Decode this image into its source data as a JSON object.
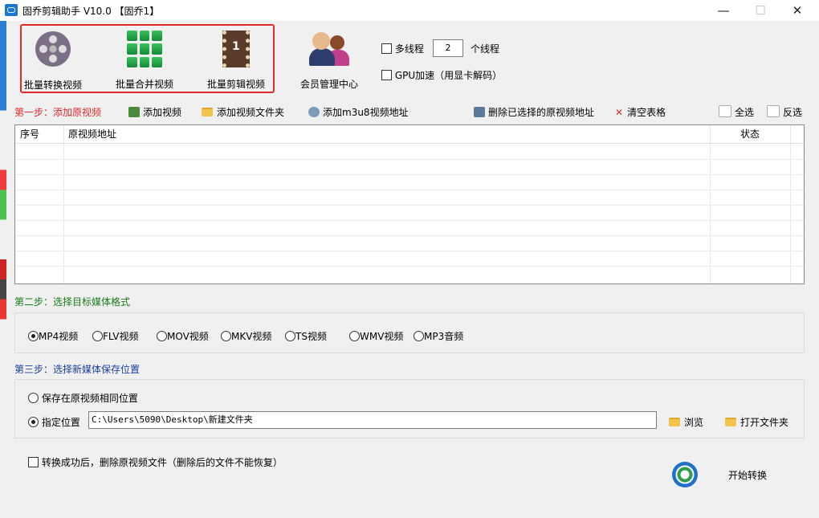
{
  "window": {
    "title": "固乔剪辑助手 V10.0  【固乔1】",
    "minimize": "—",
    "maximize": "☐",
    "close": "✕"
  },
  "toolbar": {
    "batch_convert": "批量转换视频",
    "batch_merge": "批量合并视频",
    "batch_cut": "批量剪辑视频",
    "member_center": "会员管理中心",
    "multithread_label": "多线程",
    "thread_count": "2",
    "thread_unit": "个线程",
    "gpu_label": "GPU加速（用显卡解码）"
  },
  "step1": {
    "label": "第一步：添加原视频",
    "add_video": "添加视频",
    "add_folder": "添加视频文件夹",
    "add_m3u8": "添加m3u8视频地址",
    "delete_selected": "删除已选择的原视频地址",
    "clear_table": "清空表格",
    "select_all": "全选",
    "invert_select": "反选"
  },
  "table": {
    "columns": [
      "序号",
      "原视频地址",
      "状态"
    ],
    "rows": []
  },
  "step2": {
    "label": "第二步：选择目标媒体格式",
    "formats": [
      "MP4视频",
      "FLV视频",
      "MOV视频",
      "MKV视频",
      "TS视频",
      "WMV视频",
      "MP3音频"
    ],
    "selected": "MP4视频"
  },
  "step3": {
    "label": "第三步：选择新媒体保存位置",
    "same_location": "保存在原视频相同位置",
    "custom_location": "指定位置",
    "path": "C:\\Users\\5090\\Desktop\\新建文件夹",
    "browse": "浏览",
    "open_folder": "打开文件夹"
  },
  "footer": {
    "delete_after": "转换成功后，删除原视频文件（删除后的文件不能恢复）",
    "start": "开始转换"
  },
  "colors": {
    "accent_red": "#e02b2b",
    "step1_red": "#e02b2b",
    "step2_green": "#1a7a1a",
    "step3_blue": "#1a3fa0"
  }
}
